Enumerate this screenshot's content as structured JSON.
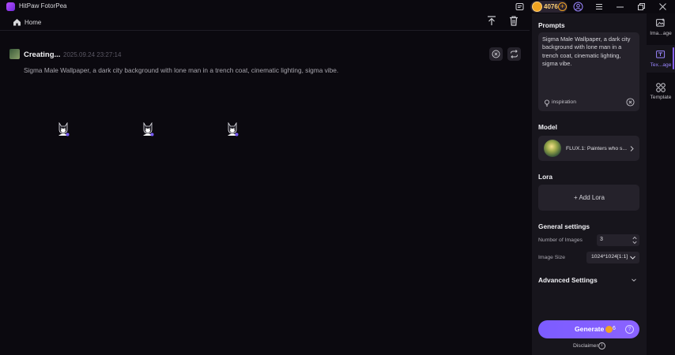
{
  "app": {
    "title": "HitPaw FotorPea",
    "credits": "4076"
  },
  "nav": {
    "home_label": "Home"
  },
  "task": {
    "status": "Creating...",
    "timestamp": "2025.09.24  23:27:14",
    "prompt": "Sigma Male Wallpaper, a dark city background with lone man in a trench coat, cinematic lighting, sigma vibe."
  },
  "panel": {
    "prompts_title": "Prompts",
    "prompt_text": "Sigma Male Wallpaper, a dark city background with lone man in a trench coat, cinematic lighting, sigma vibe.",
    "inspiration_label": "inspiration",
    "model_title": "Model",
    "model_name": "FLUX.1: Painters who s...",
    "lora_title": "Lora",
    "add_lora": "+ Add Lora",
    "general_title": "General settings",
    "num_images_label": "Number of Images",
    "num_images_value": "3",
    "image_size_label": "Image Size",
    "image_size_value": "1024*1024[1:1]",
    "advanced_title": "Advanced Settings",
    "generate_label": "Generate",
    "generate_cost": "6",
    "disclaimer": "Disclaimer"
  },
  "rail": {
    "items": [
      {
        "label": "Ima...age",
        "icon": "image-icon"
      },
      {
        "label": "Tex...age",
        "icon": "text-to-image-icon"
      },
      {
        "label": "Template",
        "icon": "template-icon"
      }
    ]
  },
  "colors": {
    "accent": "#8a63ff",
    "coin": "#f0a321",
    "panel": "#17151c",
    "background": "#0b090f"
  }
}
